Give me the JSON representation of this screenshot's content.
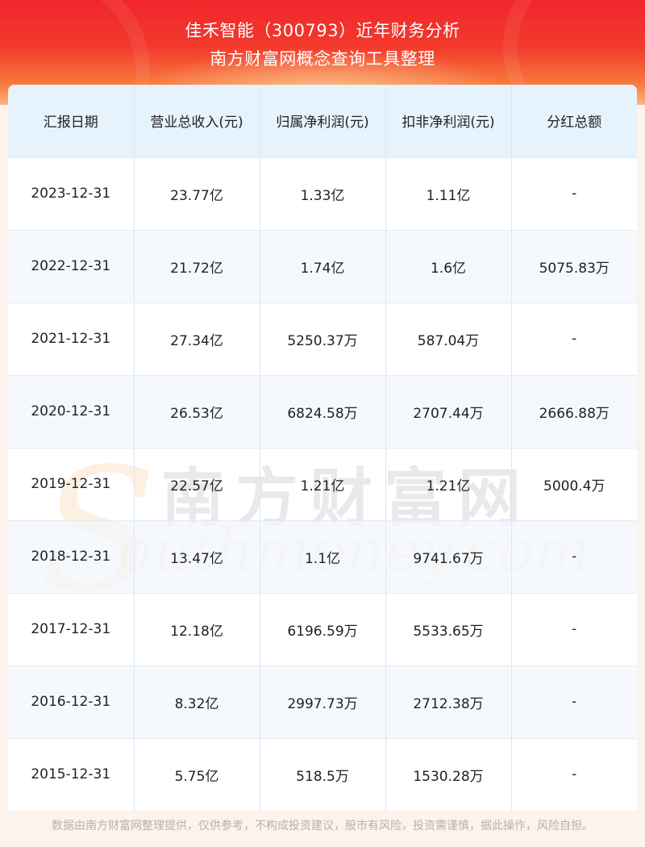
{
  "header": {
    "title_line1": "佳禾智能（300793）近年财务分析",
    "title_line2": "南方财富网概念查询工具整理"
  },
  "table": {
    "columns": [
      "汇报日期",
      "营业总收入(元)",
      "归属净利润(元)",
      "扣非净利润(元)",
      "分红总额"
    ],
    "rows": [
      [
        "2023-12-31",
        "23.77亿",
        "1.33亿",
        "1.11亿",
        "-"
      ],
      [
        "2022-12-31",
        "21.72亿",
        "1.74亿",
        "1.6亿",
        "5075.83万"
      ],
      [
        "2021-12-31",
        "27.34亿",
        "5250.37万",
        "587.04万",
        "-"
      ],
      [
        "2020-12-31",
        "26.53亿",
        "6824.58万",
        "2707.44万",
        "2666.88万"
      ],
      [
        "2019-12-31",
        "22.57亿",
        "1.21亿",
        "1.21亿",
        "5000.4万"
      ],
      [
        "2018-12-31",
        "13.47亿",
        "1.1亿",
        "9741.67万",
        "-"
      ],
      [
        "2017-12-31",
        "12.18亿",
        "6196.59万",
        "5533.65万",
        "-"
      ],
      [
        "2016-12-31",
        "8.32亿",
        "2997.73万",
        "2712.38万",
        "-"
      ],
      [
        "2015-12-31",
        "5.75亿",
        "518.5万",
        "1530.28万",
        "-"
      ]
    ]
  },
  "watermark": {
    "brand_cn": "南方财富网",
    "brand_en": "outhmoney.com",
    "brand_letter": "S"
  },
  "footer": {
    "disclaimer": "数据由南方财富网整理提供，仅供参考，不构成投资建议，股市有风险，投资需谨慎，据此操作，风险自担。"
  },
  "colors": {
    "header_red": "#f0262b",
    "header_orange": "#f77a3d",
    "table_header_bg": "#e6f2fc",
    "footer_text": "#b9b0aa"
  }
}
